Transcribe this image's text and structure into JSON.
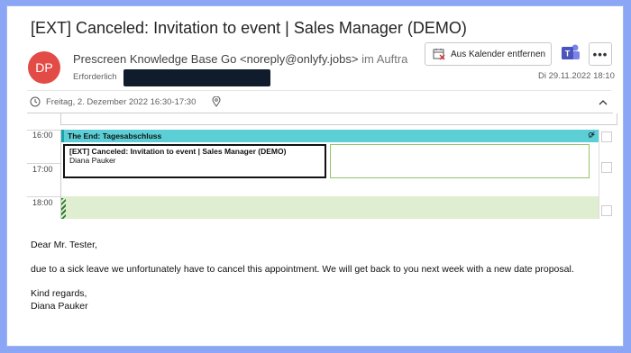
{
  "message": {
    "subject": "[EXT] Canceled: Invitation to event | Sales Manager (DEMO)",
    "avatar_initials": "DP",
    "sender_name": "Prescreen Knowledge Base Go <noreply@onlyfy.jobs>",
    "sender_on_behalf": "im Auftrag vo",
    "required_label": "Erforderlich",
    "sent_date": "Di 29.11.2022 18:10",
    "event_time": "Freitag, 2. Dezember 2022 16:30-17:30"
  },
  "toolbar": {
    "remove_calendar_label": "Aus Kalender entfernen",
    "more_label": "•••"
  },
  "calendar": {
    "times": [
      "16:00",
      "17:00",
      "18:00"
    ],
    "allday_event_title": "The End: Tagesabschluss",
    "event_title": "[EXT] Canceled: Invitation to event | Sales Manager (DEMO)",
    "event_organizer": "Diana Pauker"
  },
  "body": {
    "greeting": "Dear Mr. Tester,",
    "paragraph": "due to a sick leave we unfortunately have to cancel this appointment. We will get back to you next week with a new date proposal.",
    "closing": "Kind regards,",
    "signature": "Diana Pauker"
  },
  "colors": {
    "avatar": "#e34b47",
    "allday_event": "#5ccfd6",
    "free_time": "#dfeed0",
    "teams": "#4b53bc"
  }
}
